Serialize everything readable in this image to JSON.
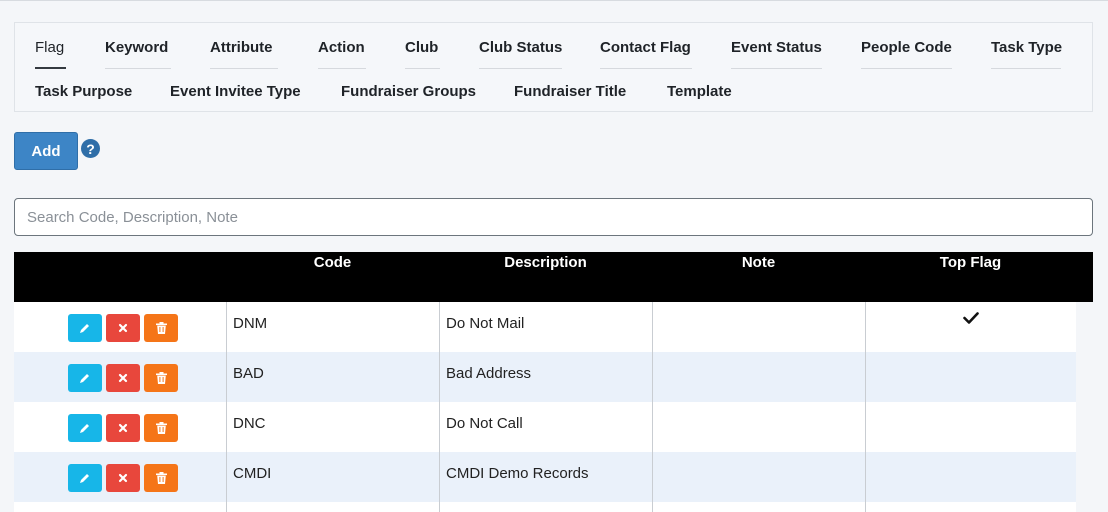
{
  "tabs": [
    {
      "label": "Flag",
      "active": true
    },
    {
      "label": "Keyword"
    },
    {
      "label": "Attribute"
    },
    {
      "label": "Action"
    },
    {
      "label": "Club"
    },
    {
      "label": "Club Status"
    },
    {
      "label": "Contact Flag"
    },
    {
      "label": "Event Status"
    },
    {
      "label": "People Code"
    },
    {
      "label": "Task Type"
    },
    {
      "label": "Task Purpose"
    },
    {
      "label": "Event Invitee Type"
    },
    {
      "label": "Fundraiser Groups"
    },
    {
      "label": "Fundraiser Title"
    },
    {
      "label": "Template"
    }
  ],
  "toolbar": {
    "add_label": "Add",
    "help_glyph": "?"
  },
  "search": {
    "placeholder": "Search Code, Description, Note",
    "value": ""
  },
  "table": {
    "columns": [
      "",
      "Code",
      "Description",
      "Note",
      "Top Flag"
    ],
    "rows": [
      {
        "code": "DNM",
        "description": "Do Not Mail",
        "note": "",
        "top_flag": true
      },
      {
        "code": "BAD",
        "description": "Bad Address",
        "note": "",
        "top_flag": false
      },
      {
        "code": "DNC",
        "description": "Do Not Call",
        "note": "",
        "top_flag": false
      },
      {
        "code": "CMDI",
        "description": "CMDI Demo Records",
        "note": "",
        "top_flag": false
      }
    ]
  },
  "icons": {
    "edit": "pencil-icon",
    "cancel": "x-icon",
    "delete": "trash-icon",
    "top_flag": "checkmark-icon",
    "help": "question-circle-icon"
  },
  "colors": {
    "primary": "#3d85c6",
    "edit": "#17b6e8",
    "cancel": "#e8473c",
    "delete": "#f57518",
    "header_bg": "#000000",
    "row_alt": "#eaf1fa"
  }
}
